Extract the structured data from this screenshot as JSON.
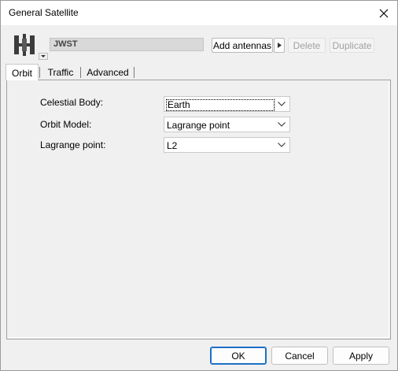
{
  "window": {
    "title": "General Satellite"
  },
  "header": {
    "satellite_icon": "satellite-icon",
    "name_value": "JWST",
    "add_antennas_label": "Add antennas",
    "delete_label": "Delete",
    "duplicate_label": "Duplicate"
  },
  "tabs": [
    {
      "label": "Orbit",
      "active": true
    },
    {
      "label": "Traffic",
      "active": false
    },
    {
      "label": "Advanced",
      "active": false
    }
  ],
  "orbit": {
    "fields": [
      {
        "label": "Celestial Body:",
        "value": "Earth"
      },
      {
        "label": "Orbit Model:",
        "value": "Lagrange point"
      },
      {
        "label": "Lagrange point:",
        "value": "L2"
      }
    ]
  },
  "footer": {
    "ok_label": "OK",
    "cancel_label": "Cancel",
    "apply_label": "Apply"
  },
  "colors": {
    "accent": "#1c6fc6",
    "window_bg": "#f0f0f0",
    "titlebar_bg": "#ffffff"
  }
}
